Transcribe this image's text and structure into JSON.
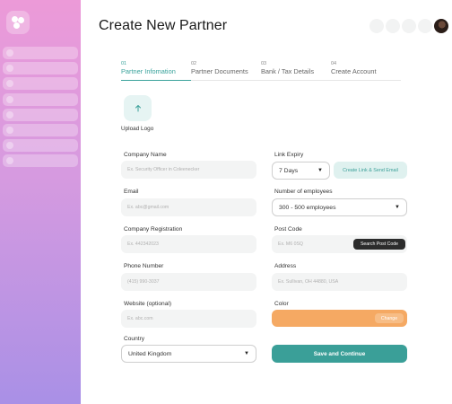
{
  "page": {
    "title": "Create New Partner"
  },
  "steps": [
    {
      "num": "01",
      "label": "Partner Infomation"
    },
    {
      "num": "02",
      "label": "Partner Documents"
    },
    {
      "num": "03",
      "label": "Bank / Tax Details"
    },
    {
      "num": "04",
      "label": "Create Account"
    }
  ],
  "upload": {
    "label": "Upload Logo",
    "icon": "upload-arrow-icon"
  },
  "fields": {
    "company_name": {
      "label": "Company Name",
      "placeholder": "Ex. Security Officer in Coleenecker"
    },
    "email": {
      "label": "Email",
      "placeholder": "Ex. abc@gmail.com"
    },
    "company_registration": {
      "label": "Company Registration",
      "placeholder": "Ex. 442342023"
    },
    "phone_number": {
      "label": "Phone Number",
      "placeholder": "(415) 990-3037"
    },
    "website": {
      "label": "Website (optional)",
      "placeholder": "Ex. abc.com"
    },
    "country": {
      "label": "Country",
      "value": "United Kingdom"
    },
    "link_expiry": {
      "label": "Link Expiry",
      "value": "7 Days"
    },
    "employees": {
      "label": "Number of employees",
      "value": "300 - 500 employees"
    },
    "post_code": {
      "label": "Post Code",
      "placeholder": "Ex. M6 0SQ"
    },
    "address": {
      "label": "Address",
      "placeholder": "Ex. Sullivan, OH 44880, USA"
    },
    "color": {
      "label": "Color",
      "value_hex": "#f5a963"
    }
  },
  "buttons": {
    "create_link": "Create Link & Send Email",
    "search_post_code": "Search Post Code",
    "change": "Change",
    "save": "Save and Continue"
  },
  "colors": {
    "accent": "#3a9f98",
    "selected_color": "#f5a963"
  }
}
